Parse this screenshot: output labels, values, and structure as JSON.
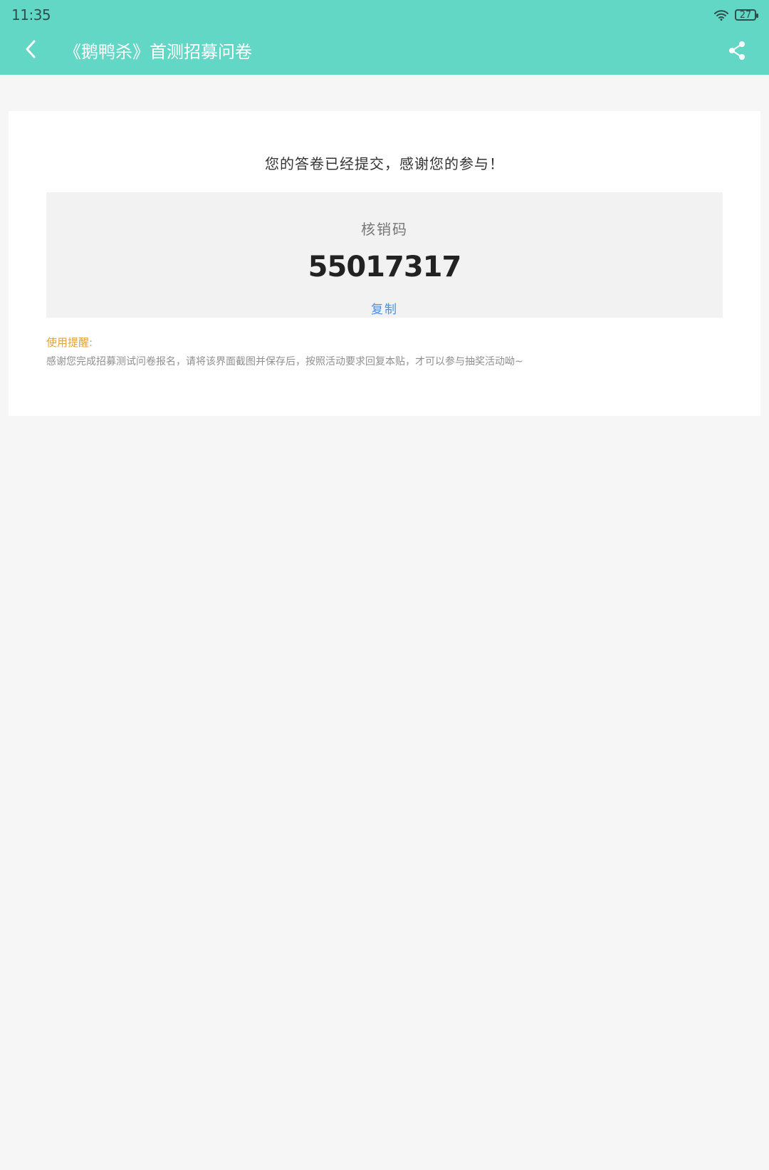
{
  "status_bar": {
    "time": "11:35",
    "battery_level": "27"
  },
  "header": {
    "title": "《鹅鸭杀》首测招募问卷",
    "back_icon": "chevron-left-icon",
    "share_icon": "share-icon"
  },
  "main": {
    "success_message": "您的答卷已经提交，感谢您的参与！",
    "code_label": "核销码",
    "code_value": "55017317",
    "copy_label": "复制",
    "tip_title": "使用提醒:",
    "tip_text": "感谢您完成招募测试问卷报名，请将该界面截图并保存后，按照活动要求回复本贴，才可以参与抽奖活动呦~"
  },
  "colors": {
    "header_bg": "#63d7c6",
    "accent_blue": "#4a90e2",
    "tip_orange": "#e1a33d"
  }
}
